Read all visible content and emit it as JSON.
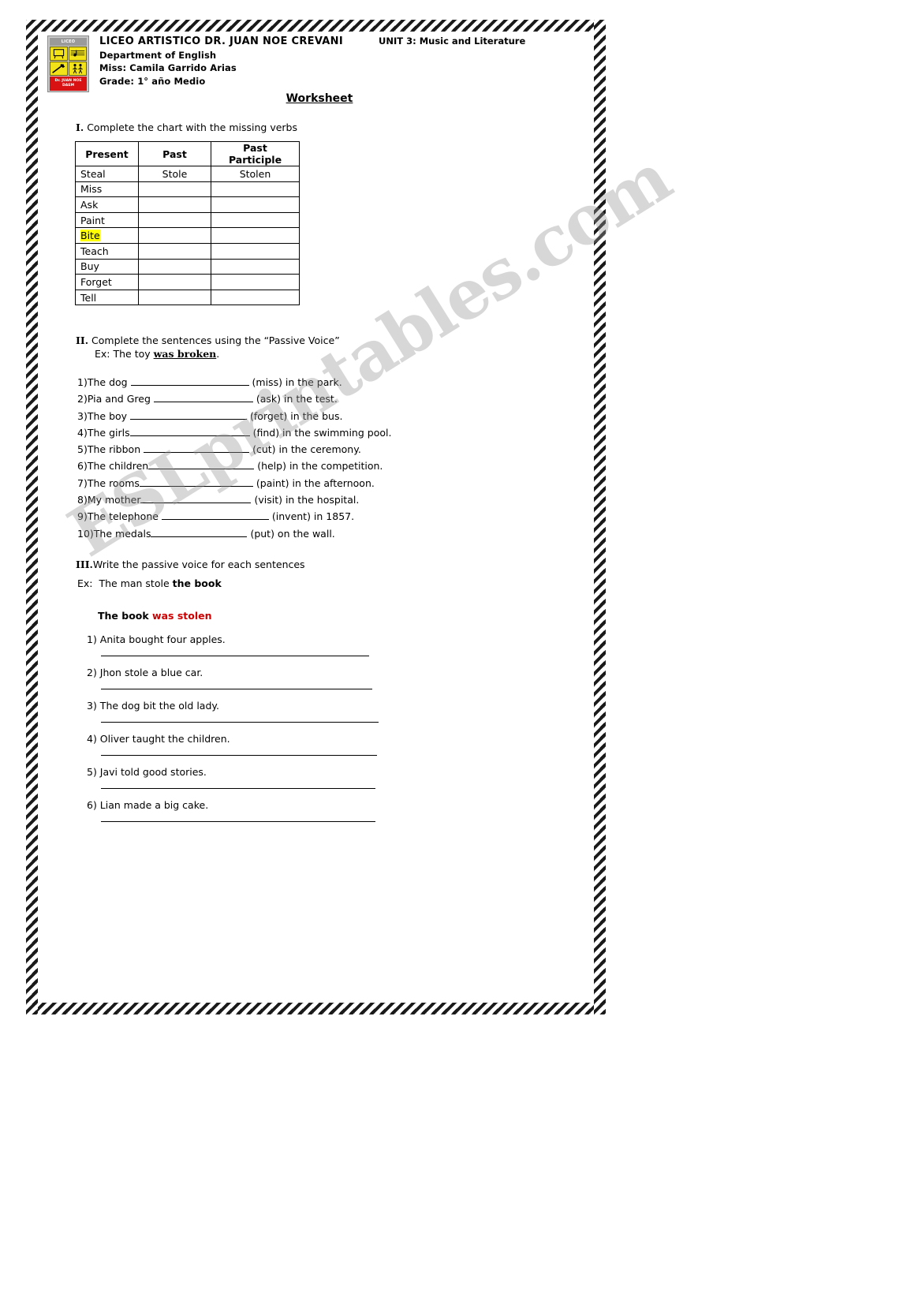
{
  "header": {
    "logo": {
      "top_label": "LICEO ARTISTICO",
      "bottom_label": "Dr. JUAN NOE DAEM"
    },
    "school": "LICEO ARTISTICO DR. JUAN NOE CREVANI",
    "department": "Department of English",
    "teacher": "Miss: Camila Garrido Arias",
    "grade": "Grade: 1° año Medio",
    "unit": "UNIT 3: Music and Literature",
    "worksheet_title": "Worksheet"
  },
  "watermark": "ESLprintables.com",
  "section1": {
    "number": "I.",
    "instruction": "Complete the chart with the missing verbs",
    "table": {
      "headers": [
        "Present",
        "Past",
        "Past Participle"
      ],
      "rows": [
        {
          "present": "Steal",
          "past": "Stole",
          "participle": "Stolen",
          "highlight": false
        },
        {
          "present": "Miss",
          "past": "",
          "participle": "",
          "highlight": false
        },
        {
          "present": "Ask",
          "past": "",
          "participle": "",
          "highlight": false
        },
        {
          "present": "Paint",
          "past": "",
          "participle": "",
          "highlight": false
        },
        {
          "present": "Bite",
          "past": "",
          "participle": "",
          "highlight": true
        },
        {
          "present": "Teach",
          "past": "",
          "participle": "",
          "highlight": false
        },
        {
          "present": "Buy",
          "past": "",
          "participle": "",
          "highlight": false
        },
        {
          "present": "Forget",
          "past": "",
          "participle": "",
          "highlight": false
        },
        {
          "present": "Tell",
          "past": "",
          "participle": "",
          "highlight": false
        }
      ]
    }
  },
  "section2": {
    "number": "II.",
    "instruction": "Complete the sentences using the “Passive Voice”",
    "example_prefix": "Ex: The toy ",
    "example_bold": "was broken",
    "example_suffix": ".",
    "items": [
      {
        "num": "1)",
        "before": "The dog ",
        "blank_width": 150,
        "after": " (miss) in the park."
      },
      {
        "num": "2)",
        "before": "Pia and Greg ",
        "blank_width": 126,
        "after": " (ask) in the test."
      },
      {
        "num": "3)",
        "before": "The boy ",
        "blank_width": 148,
        "after": " (forget) in the bus."
      },
      {
        "num": "4)",
        "before": "The girls",
        "blank_width": 152,
        "after": " (find) in the swimming pool."
      },
      {
        "num": "5)",
        "before": "The ribbon ",
        "blank_width": 134,
        "after": " (cut) in the ceremony."
      },
      {
        "num": "6)",
        "before": "The children",
        "blank_width": 134,
        "after": " (help) in the competition."
      },
      {
        "num": "7)",
        "before": "The rooms",
        "blank_width": 144,
        "after": " (paint) in the afternoon."
      },
      {
        "num": "8)",
        "before": "My mother",
        "blank_width": 140,
        "after": " (visit) in the hospital."
      },
      {
        "num": "9)",
        "before": "The telephone ",
        "blank_width": 136,
        "after": " (invent) in 1857."
      },
      {
        "num": "10)",
        "before": "The medals",
        "blank_width": 122,
        "after": " (put) on the wall."
      }
    ]
  },
  "section3": {
    "number": "III.",
    "instruction": "Write the passive voice for each sentences",
    "example_label": "Ex:",
    "example_sentence_plain": "The man stole ",
    "example_sentence_bold": "the book",
    "example_answer_black": "The book ",
    "example_answer_red": "was stolen",
    "items": [
      {
        "num": "1)",
        "text": "Anita bought four apples.",
        "line_width": 340
      },
      {
        "num": "2)",
        "text": "Jhon stole a blue car.",
        "line_width": 344
      },
      {
        "num": "3)",
        "text": "The dog bit the old lady.",
        "line_width": 352
      },
      {
        "num": "4)",
        "text": "Oliver taught the children.",
        "line_width": 350
      },
      {
        "num": "5)",
        "text": " Javi told good stories.",
        "line_width": 348
      },
      {
        "num": "6)",
        "text": "Lian made a big cake.",
        "line_width": 348
      }
    ]
  },
  "colors": {
    "highlight": "#ffff00",
    "accent_red": "#cc0000",
    "logo_yellow": "#f2e21a",
    "logo_red": "#d81212"
  }
}
